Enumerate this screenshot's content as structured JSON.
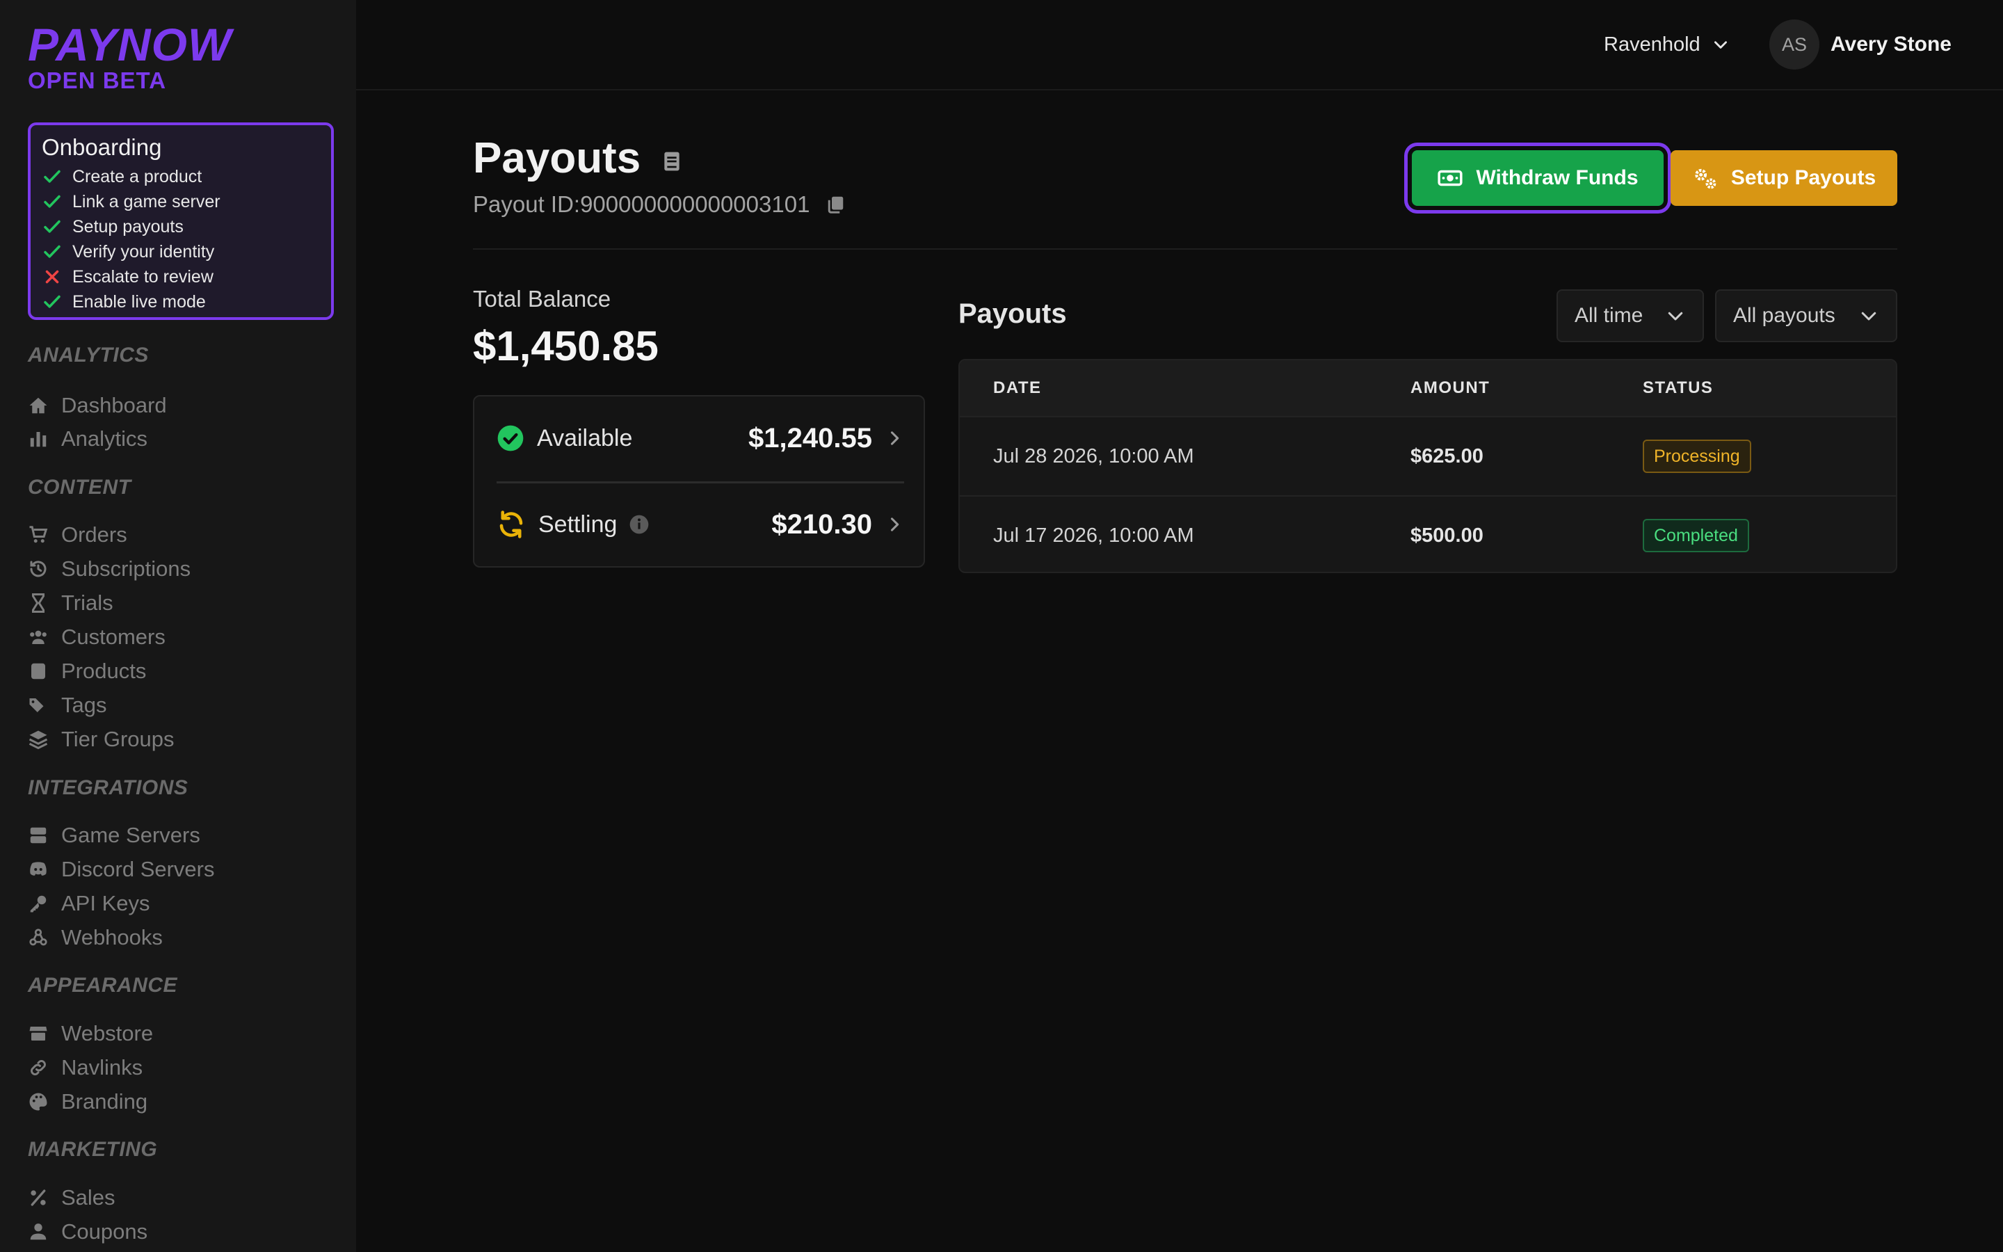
{
  "brand": {
    "name": "PAYNOW",
    "tagline": "OPEN BETA"
  },
  "onboarding": {
    "title": "Onboarding",
    "items": [
      {
        "label": "Create a product",
        "done": true
      },
      {
        "label": "Link a game server",
        "done": true
      },
      {
        "label": "Setup payouts",
        "done": true
      },
      {
        "label": "Verify your identity",
        "done": true
      },
      {
        "label": "Escalate to review",
        "done": false
      },
      {
        "label": "Enable live mode",
        "done": true
      }
    ]
  },
  "nav": {
    "analytics": {
      "title": "ANALYTICS",
      "items": [
        {
          "label": "Dashboard",
          "icon": "home-icon"
        },
        {
          "label": "Analytics",
          "icon": "bar-chart-icon"
        }
      ]
    },
    "content": {
      "title": "CONTENT",
      "items": [
        {
          "label": "Orders",
          "icon": "cart-icon"
        },
        {
          "label": "Subscriptions",
          "icon": "history-icon"
        },
        {
          "label": "Trials",
          "icon": "hourglass-icon"
        },
        {
          "label": "Customers",
          "icon": "users-icon"
        },
        {
          "label": "Products",
          "icon": "box-icon"
        },
        {
          "label": "Tags",
          "icon": "tags-icon"
        },
        {
          "label": "Tier Groups",
          "icon": "layers-icon"
        }
      ]
    },
    "integrations": {
      "title": "INTEGRATIONS",
      "items": [
        {
          "label": "Game Servers",
          "icon": "server-icon"
        },
        {
          "label": "Discord Servers",
          "icon": "discord-icon"
        },
        {
          "label": "API Keys",
          "icon": "key-icon"
        },
        {
          "label": "Webhooks",
          "icon": "webhook-icon"
        }
      ]
    },
    "appearance": {
      "title": "APPEARANCE",
      "items": [
        {
          "label": "Webstore",
          "icon": "store-icon"
        },
        {
          "label": "Navlinks",
          "icon": "link-icon"
        },
        {
          "label": "Branding",
          "icon": "palette-icon"
        }
      ]
    },
    "marketing": {
      "title": "MARKETING",
      "items": [
        {
          "label": "Sales",
          "icon": "percent-icon"
        },
        {
          "label": "Coupons",
          "icon": "coupon-icon"
        }
      ]
    }
  },
  "header": {
    "store": "Ravenhold",
    "user_initials": "AS",
    "user_name": "Avery Stone"
  },
  "page": {
    "title": "Payouts",
    "payout_id": "Payout ID:900000000000003101",
    "withdraw_label": "Withdraw Funds",
    "setup_label": "Setup Payouts"
  },
  "balance": {
    "label": "Total Balance",
    "total": "$1,450.85",
    "available_label": "Available",
    "available_value": "$1,240.55",
    "settling_label": "Settling",
    "settling_value": "$210.30"
  },
  "payouts": {
    "title": "Payouts",
    "filter_time": "All time",
    "filter_type": "All payouts",
    "columns": [
      "DATE",
      "AMOUNT",
      "STATUS"
    ],
    "rows": [
      {
        "date": "Jul 28 2026, 10:00 AM",
        "amount": "$625.00",
        "status": "Processing"
      },
      {
        "date": "Jul 17 2026, 10:00 AM",
        "amount": "$500.00",
        "status": "Completed"
      }
    ]
  },
  "colors": {
    "brand": "#7c3aed",
    "success": "#16a34a",
    "warning": "#d89614",
    "danger": "#ef4444"
  }
}
